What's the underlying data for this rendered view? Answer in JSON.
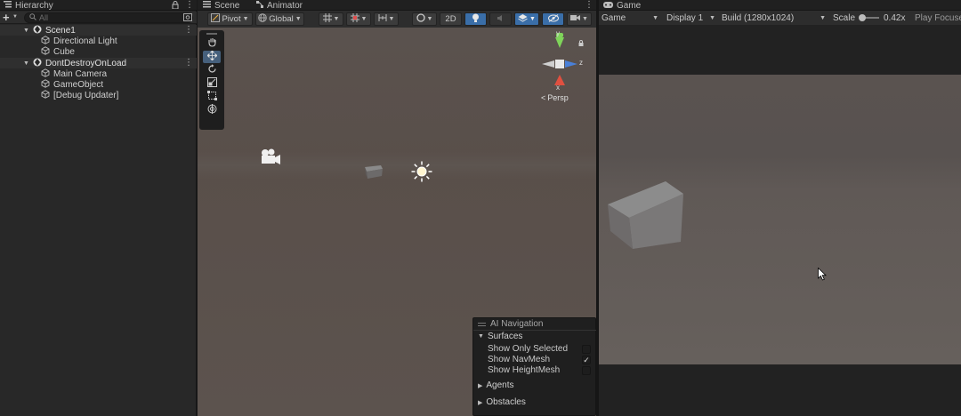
{
  "hierarchy": {
    "tab_label": "Hierarchy",
    "add_label": "+",
    "search_placeholder": "All",
    "items": [
      {
        "label": "Scene1"
      },
      {
        "label": "Directional Light"
      },
      {
        "label": "Cube"
      },
      {
        "label": "DontDestroyOnLoad"
      },
      {
        "label": "Main Camera"
      },
      {
        "label": "GameObject"
      },
      {
        "label": "[Debug Updater]"
      }
    ]
  },
  "scene": {
    "tabs": [
      {
        "label": "Scene"
      },
      {
        "label": "Animator"
      }
    ],
    "toolbar": {
      "pivot_label": "Pivot",
      "global_label": "Global",
      "mode_2d_label": "2D"
    },
    "gizmo": {
      "persp_label": "Persp",
      "axis_y": "y",
      "axis_z": "z",
      "axis_x": "x"
    },
    "ai_navigation": {
      "title": "AI Navigation",
      "surfaces_label": "Surfaces",
      "show_only_selected_label": "Show Only Selected",
      "show_only_selected_checked": false,
      "show_navmesh_label": "Show NavMesh",
      "show_navmesh_checked": true,
      "show_heightmesh_label": "Show HeightMesh",
      "show_heightmesh_checked": false,
      "agents_label": "Agents",
      "obstacles_label": "Obstacles"
    }
  },
  "game": {
    "tab_label": "Game",
    "view_dropdown": "Game",
    "display_dropdown": "Display 1",
    "resolution_dropdown": "Build (1280x1024)",
    "scale_label": "Scale",
    "scale_value": "0.42x",
    "play_focused_label": "Play Focuse"
  },
  "colors": {
    "accent_blue": "#3a6ea8",
    "panel_bg": "#282828",
    "scene_bg": "#59514d",
    "game_sky": "#585250",
    "game_ground": "#67605c"
  }
}
